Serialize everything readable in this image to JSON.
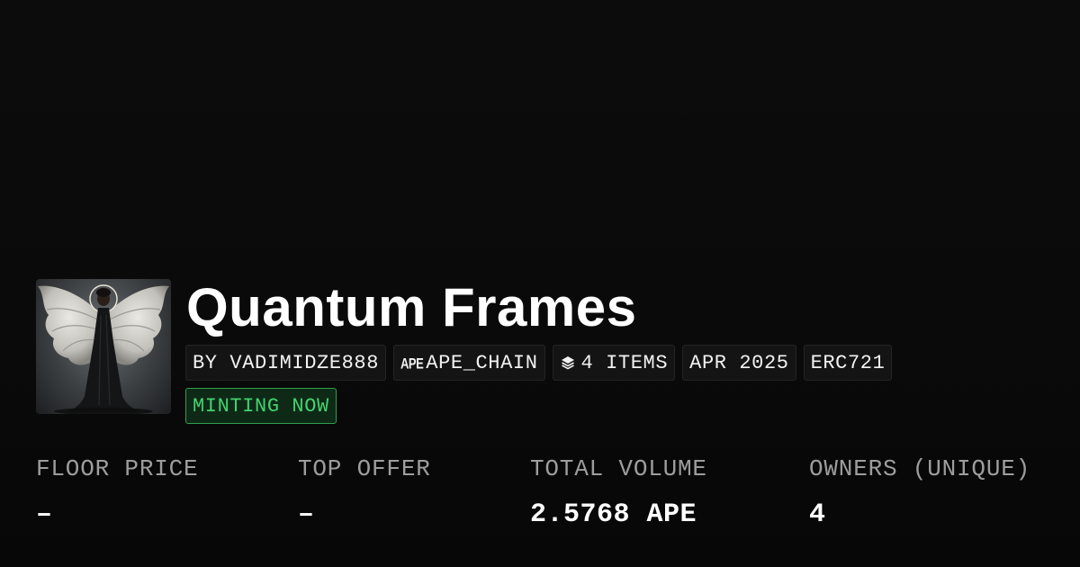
{
  "collection": {
    "name": "Quantum Frames",
    "creator": "BY VADIMIDZE888",
    "chain_mark": "APE",
    "chain": "APE_CHAIN",
    "items": "4 ITEMS",
    "date": "APR 2025",
    "standard": "ERC721",
    "status": "MINTING NOW",
    "status_color": "#45d16f"
  },
  "stats": [
    {
      "label": "FLOOR PRICE",
      "value": "–"
    },
    {
      "label": "TOP OFFER",
      "value": "–"
    },
    {
      "label": "TOTAL VOLUME",
      "value": "2.5768 APE"
    },
    {
      "label": "OWNERS (UNIQUE)",
      "value": "4"
    }
  ],
  "icons": {
    "avatar": "angel-artwork-image",
    "items": "layers-icon"
  }
}
